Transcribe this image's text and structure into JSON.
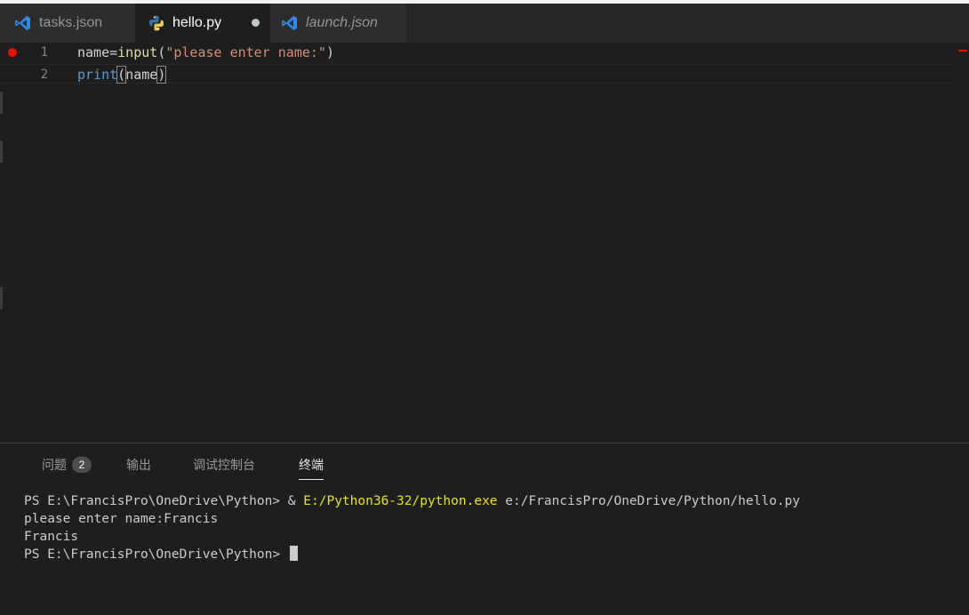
{
  "tabs": [
    {
      "label": "tasks.json",
      "icon": "vscode-icon",
      "active": false
    },
    {
      "label": "hello.py",
      "icon": "python-icon",
      "active": true,
      "unsaved": true
    },
    {
      "label": "launch.json",
      "icon": "vscode-icon",
      "active": false,
      "italic": true
    }
  ],
  "editor": {
    "lines": [
      {
        "number": "1",
        "breakpoint": true,
        "tokens": [
          "name",
          "=",
          "input",
          "(",
          "\"please enter name:\"",
          ")"
        ]
      },
      {
        "number": "2",
        "breakpoint": false,
        "tokens": [
          "print",
          "(",
          "name",
          ")"
        ]
      }
    ]
  },
  "panel": {
    "tabs": [
      {
        "label": "问题",
        "badge": "2"
      },
      {
        "label": "输出"
      },
      {
        "label": "调试控制台"
      },
      {
        "label": "终端",
        "active": true
      }
    ]
  },
  "terminal": {
    "line1_prompt": "PS E:\\FrancisPro\\OneDrive\\Python> & ",
    "line1_exe": "E:/Python36-32/python.exe",
    "line1_arg": " e:/FrancisPro/OneDrive/Python/hello.py",
    "line2": "please enter name:Francis",
    "line3": "Francis",
    "line4_prompt": "PS E:\\FrancisPro\\OneDrive\\Python> "
  },
  "colors": {
    "background": "#1e1e1e",
    "tab_bar": "#252526",
    "inactive_tab": "#2d2d2d",
    "breakpoint": "#e51400",
    "string": "#ce9178",
    "function": "#dcdcaa",
    "keyword": "#569cd6",
    "terminal_exe": "#e5e510"
  }
}
